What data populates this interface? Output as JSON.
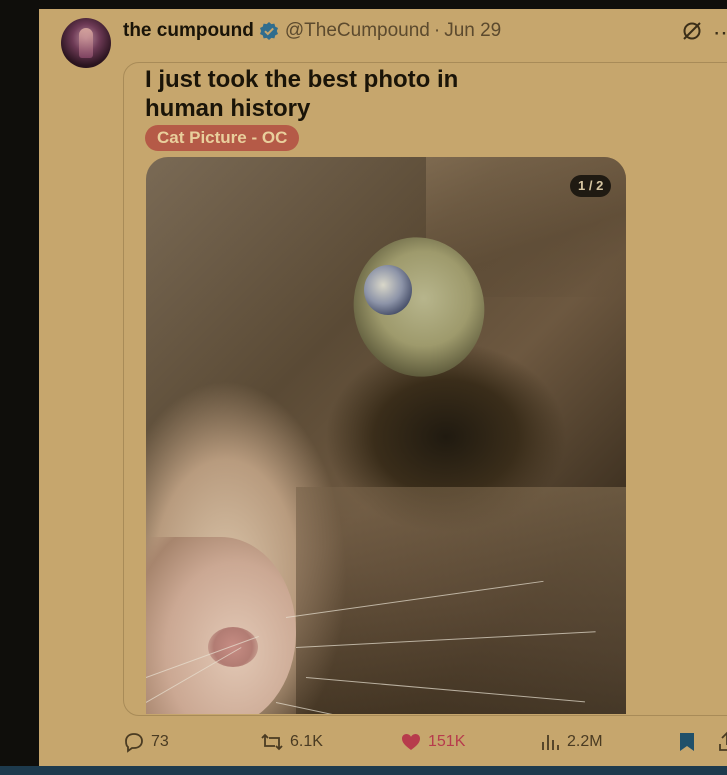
{
  "author": {
    "name": "the cumpound",
    "handle": "@TheCumpound",
    "separator": "·",
    "date": "Jun 29"
  },
  "post": {
    "title": "I just took the best photo in human history",
    "flair": "Cat Picture - OC",
    "media_counter": "1 / 2"
  },
  "actions": {
    "replies": "73",
    "reposts": "6.1K",
    "likes": "151K",
    "views": "2.2M"
  },
  "colors": {
    "background": "#c6a66d",
    "flair": "#b55a47",
    "like": "#b73b4c",
    "verified": "#2f6d8e",
    "bookmark": "#20506a"
  },
  "icons": [
    "verified-badge-icon",
    "grok-icon",
    "more-icon",
    "reply-icon",
    "repost-icon",
    "heart-icon",
    "views-icon",
    "bookmark-icon",
    "share-icon"
  ]
}
